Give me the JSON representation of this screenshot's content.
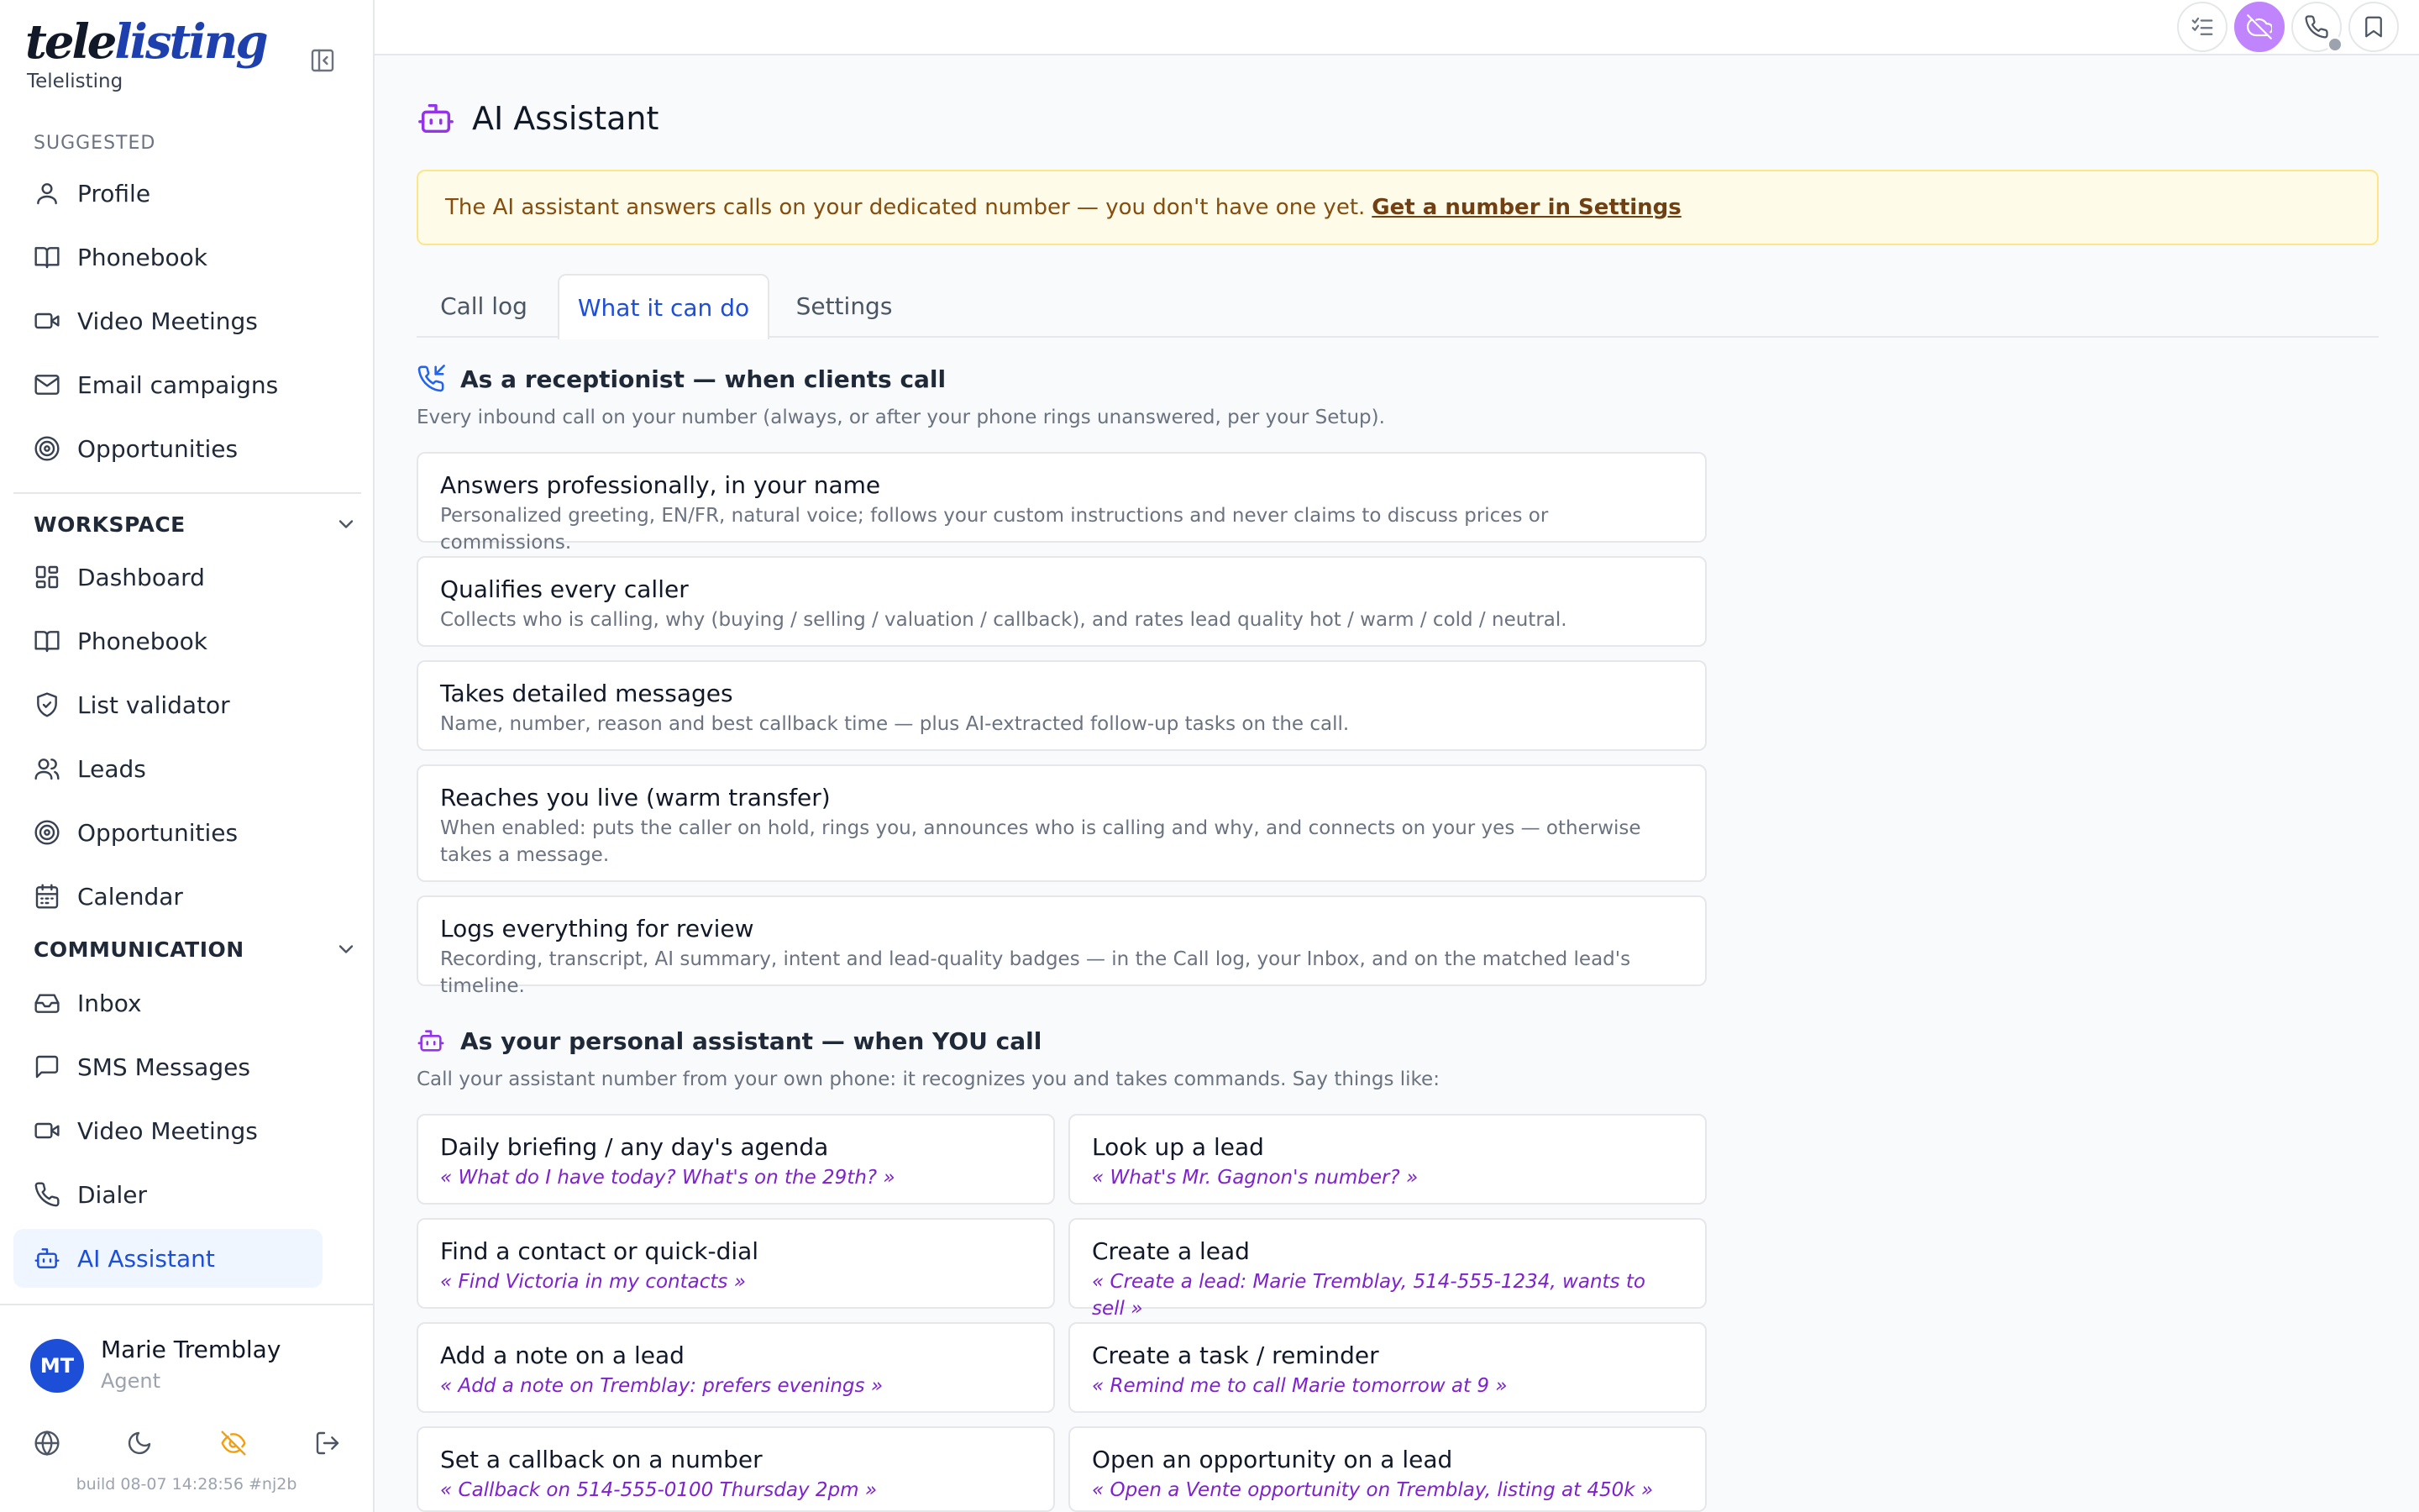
{
  "brand": {
    "logo_dark": "tele",
    "logo_blue": "listing",
    "subtitle": "Telelisting"
  },
  "sidebar": {
    "suggested_label": "SUGGESTED",
    "suggested": [
      {
        "label": "Profile",
        "icon": "user-icon"
      },
      {
        "label": "Phonebook",
        "icon": "book-icon"
      },
      {
        "label": "Video Meetings",
        "icon": "video-icon"
      },
      {
        "label": "Email campaigns",
        "icon": "mail-icon"
      },
      {
        "label": "Opportunities",
        "icon": "target-icon"
      }
    ],
    "workspace_label": "WORKSPACE",
    "workspace": [
      {
        "label": "Dashboard",
        "icon": "dashboard-icon"
      },
      {
        "label": "Phonebook",
        "icon": "book-icon"
      },
      {
        "label": "List validator",
        "icon": "shield-check-icon"
      },
      {
        "label": "Leads",
        "icon": "users-icon"
      },
      {
        "label": "Opportunities",
        "icon": "target-icon"
      },
      {
        "label": "Calendar",
        "icon": "calendar-icon"
      }
    ],
    "communication_label": "COMMUNICATION",
    "communication": [
      {
        "label": "Inbox",
        "icon": "inbox-icon"
      },
      {
        "label": "SMS Messages",
        "icon": "message-icon"
      },
      {
        "label": "Video Meetings",
        "icon": "video-icon"
      },
      {
        "label": "Dialer",
        "icon": "phone-icon"
      },
      {
        "label": "AI Assistant",
        "icon": "bot-icon",
        "active": true
      }
    ]
  },
  "user": {
    "initials": "MT",
    "name": "Marie Tremblay",
    "role": "Agent",
    "build": "build 08-07 14:28:56 #nj2b"
  },
  "page": {
    "title": "AI Assistant",
    "banner_text": "The AI assistant answers calls on your dedicated number — you don't have one yet.",
    "banner_link": "Get a number in Settings",
    "tabs": [
      "Call log",
      "What it can do",
      "Settings"
    ],
    "active_tab": 1
  },
  "receptionist": {
    "title": "As a receptionist — when clients call",
    "desc": "Every inbound call on your number (always, or after your phone rings unanswered, per your Setup).",
    "cards": [
      {
        "title": "Answers professionally, in your name",
        "desc": "Personalized greeting, EN/FR, natural voice; follows your custom instructions and never claims to discuss prices or commissions."
      },
      {
        "title": "Qualifies every caller",
        "desc": "Collects who is calling, why (buying / selling / valuation / callback), and rates lead quality hot / warm / cold / neutral."
      },
      {
        "title": "Takes detailed messages",
        "desc": "Name, number, reason and best callback time — plus AI-extracted follow-up tasks on the call."
      },
      {
        "title": "Reaches you live (warm transfer)",
        "desc": "When enabled: puts the caller on hold, rings you, announces who is calling and why, and connects on your yes — otherwise takes a message."
      },
      {
        "title": "Logs everything for review",
        "desc": "Recording, transcript, AI summary, intent and lead-quality badges — in the Call log, your Inbox, and on the matched lead's timeline."
      }
    ]
  },
  "personal": {
    "title": "As your personal assistant — when YOU call",
    "desc": "Call your assistant number from your own phone: it recognizes you and takes commands. Say things like:",
    "commands": [
      {
        "title": "Daily briefing / any day's agenda",
        "example": "« What do I have today? What's on the 29th? »"
      },
      {
        "title": "Look up a lead",
        "example": "« What's Mr. Gagnon's number? »"
      },
      {
        "title": "Find a contact or quick-dial",
        "example": "« Find Victoria in my contacts »"
      },
      {
        "title": "Create a lead",
        "example": "« Create a lead: Marie Tremblay, 514-555-1234, wants to sell »"
      },
      {
        "title": "Add a note on a lead",
        "example": "« Add a note on Tremblay: prefers evenings »"
      },
      {
        "title": "Create a task / reminder",
        "example": "« Remind me to call Marie tomorrow at 9 »"
      },
      {
        "title": "Set a callback on a number",
        "example": "« Callback on 514-555-0100 Thursday 2pm »"
      },
      {
        "title": "Open an opportunity on a lead",
        "example": "« Open a Vente opportunity on Tremblay, listing at 450k »"
      }
    ]
  },
  "colors": {
    "accent": "#1d4ed8",
    "purple": "#9333ea",
    "banner_bg": "#fefce8",
    "banner_text": "#854d0e"
  }
}
